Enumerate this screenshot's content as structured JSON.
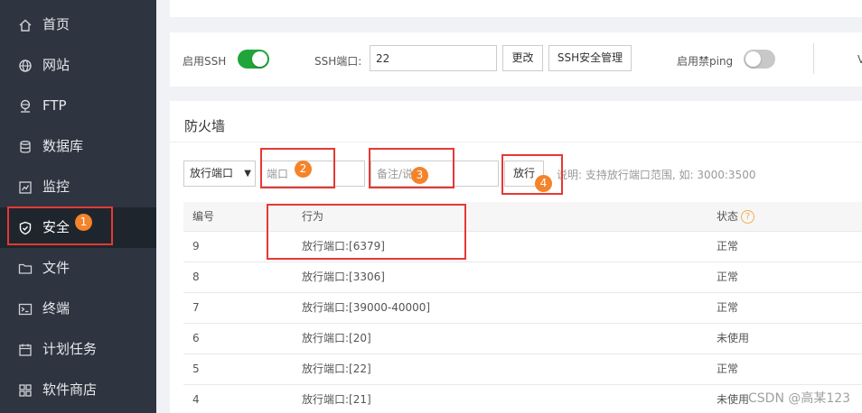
{
  "sidebar": {
    "items": [
      {
        "label": "首页",
        "icon": "home-icon"
      },
      {
        "label": "网站",
        "icon": "globe-icon"
      },
      {
        "label": "FTP",
        "icon": "ftp-icon"
      },
      {
        "label": "数据库",
        "icon": "database-icon"
      },
      {
        "label": "监控",
        "icon": "monitor-icon"
      },
      {
        "label": "安全",
        "icon": "shield-icon",
        "active": true
      },
      {
        "label": "文件",
        "icon": "folder-icon"
      },
      {
        "label": "终端",
        "icon": "terminal-icon"
      },
      {
        "label": "计划任务",
        "icon": "calendar-icon"
      },
      {
        "label": "软件商店",
        "icon": "grid-icon"
      }
    ]
  },
  "ssh": {
    "enable_label": "启用SSH",
    "enable_on": true,
    "port_label": "SSH端口:",
    "port_value": "22",
    "change_button": "更改",
    "manage_button": "SSH安全管理",
    "ping_label": "启用禁ping",
    "ping_on": false,
    "cut_text": "V"
  },
  "firewall": {
    "title": "防火墙",
    "action_select": "放行端口",
    "port_placeholder": "端口",
    "remark_placeholder": "备注/说",
    "release_button": "放行",
    "hint": "说明: 支持放行端口范围, 如: 3000:3500",
    "table": {
      "headers": {
        "id": "编号",
        "action": "行为",
        "status": "状态"
      },
      "help_icon": "?",
      "rows": [
        {
          "id": "9",
          "action": "放行端口:[6379]",
          "status": "正常"
        },
        {
          "id": "8",
          "action": "放行端口:[3306]",
          "status": "正常"
        },
        {
          "id": "7",
          "action": "放行端口:[39000-40000]",
          "status": "正常"
        },
        {
          "id": "6",
          "action": "放行端口:[20]",
          "status": "未使用"
        },
        {
          "id": "5",
          "action": "放行端口:[22]",
          "status": "正常"
        },
        {
          "id": "4",
          "action": "放行端口:[21]",
          "status": "未使用"
        }
      ]
    }
  },
  "annotations": [
    "1",
    "2",
    "3",
    "4"
  ],
  "watermark": "CSDN @高某123",
  "colors": {
    "accent": "#20a53a",
    "sidebar_bg": "#2e3540",
    "annotation_red": "#e53935",
    "marker_orange": "#f5832a"
  }
}
